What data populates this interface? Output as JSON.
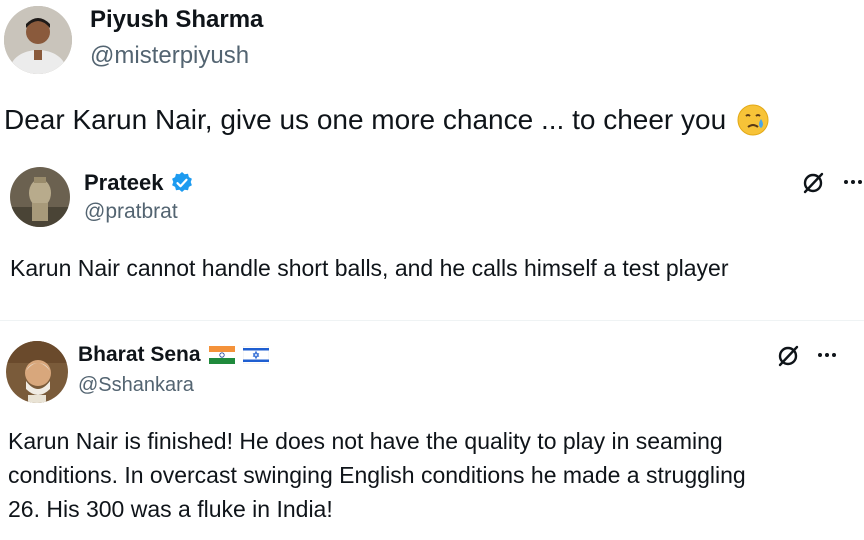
{
  "header_post": {
    "name": "Piyush Sharma",
    "handle": "@misterpiyush",
    "text": "Dear Karun Nair, give us one more chance ... to cheer you",
    "emoji": "crying-face-emoji"
  },
  "quotes": [
    {
      "name": "Prateek",
      "handle": "@pratbrat",
      "verified": true,
      "text": "Karun Nair cannot handle short balls, and he calls himself a test player"
    },
    {
      "name": "Bharat Sena",
      "handle": "@Sshankara",
      "flags": [
        "india-flag-icon",
        "israel-flag-icon"
      ],
      "text_lines": [
        "Karun Nair is finished! He does not have the quality to play in seaming",
        "conditions. In overcast swinging English conditions he made a struggling",
        "26. His 300 was a fluke in India!"
      ]
    }
  ],
  "icons": {
    "grok": "grok-icon",
    "more": "more-options-icon",
    "verified": "verified-badge-icon"
  },
  "colors": {
    "text": "#0f1419",
    "muted": "#536471",
    "verified_blue": "#1d9bf0",
    "divider": "#eff3f4"
  }
}
